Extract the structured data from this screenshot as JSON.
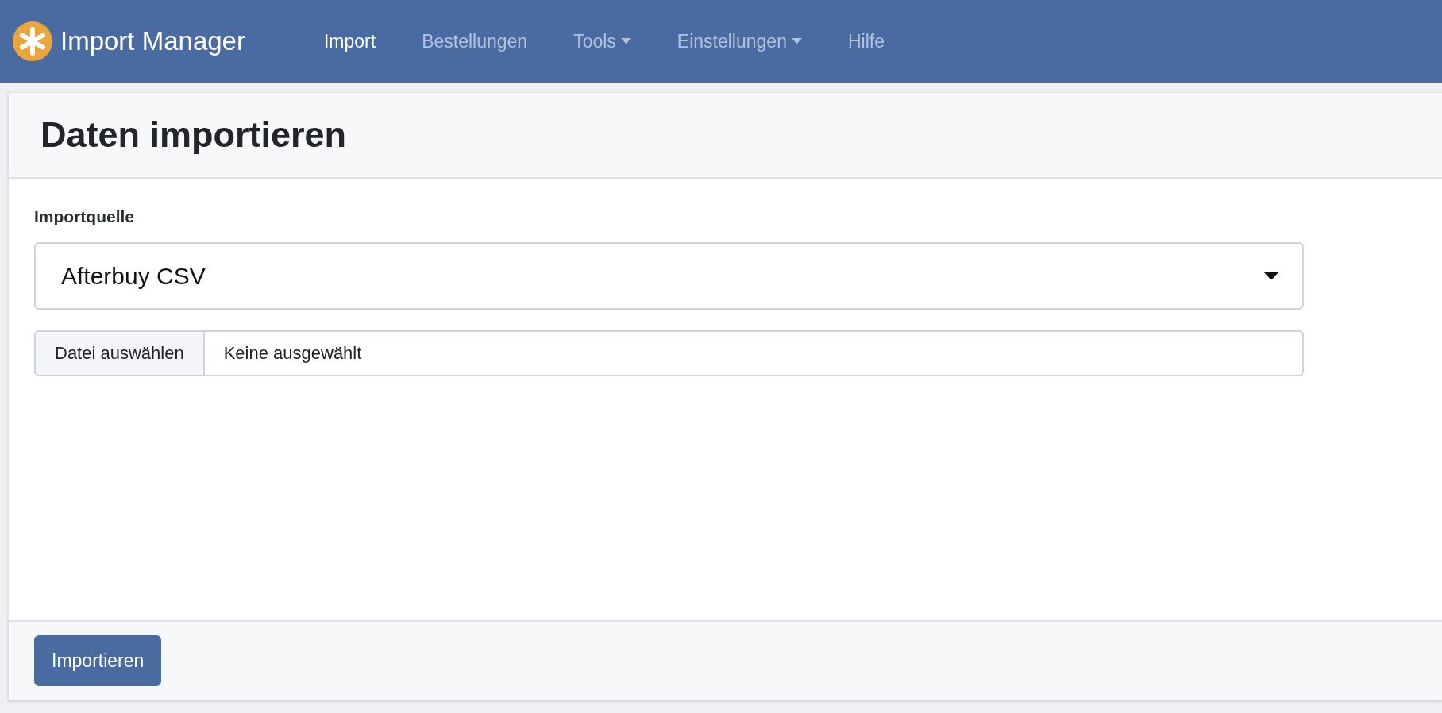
{
  "brand": {
    "title": "Import Manager"
  },
  "nav": [
    {
      "label": "Import",
      "selected": true,
      "dropdown": false
    },
    {
      "label": "Bestellungen",
      "selected": false,
      "dropdown": false
    },
    {
      "label": "Tools",
      "selected": false,
      "dropdown": true
    },
    {
      "label": "Einstellungen",
      "selected": false,
      "dropdown": true
    },
    {
      "label": "Hilfe",
      "selected": false,
      "dropdown": false
    }
  ],
  "card": {
    "title": "Daten importieren",
    "source_label": "Importquelle",
    "source_value": "Afterbuy CSV",
    "file_button": "Datei auswählen",
    "file_status": "Keine ausgewählt",
    "submit": "Importieren"
  }
}
